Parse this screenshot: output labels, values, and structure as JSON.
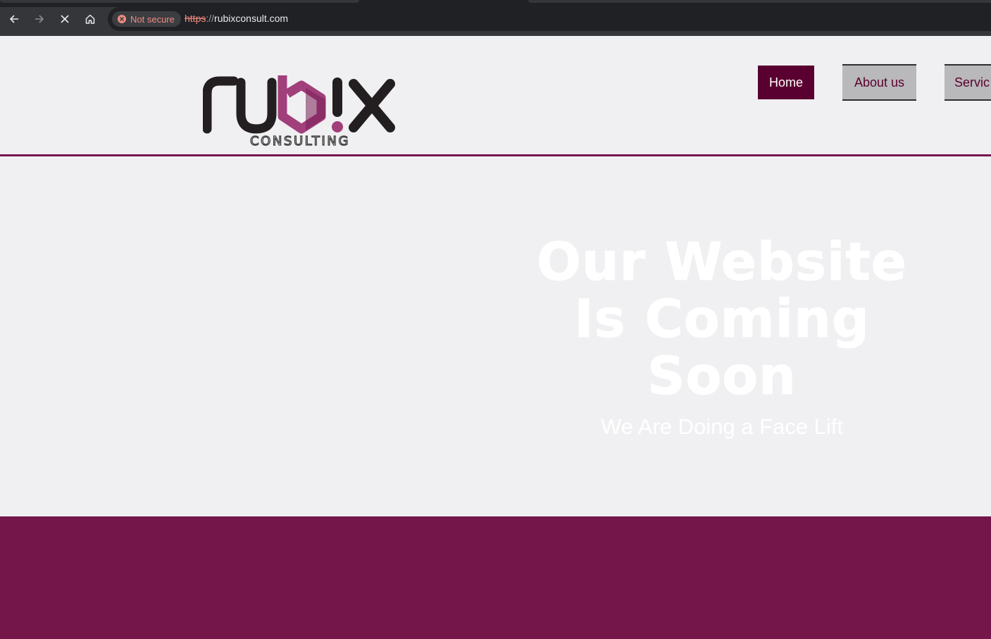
{
  "browser": {
    "security_label": "Not secure",
    "url_scheme": "https",
    "url_separator": "://",
    "url_host": "rubixconsult.com"
  },
  "site": {
    "logo_text": "rub!x",
    "logo_subtext": "CONSULTING",
    "nav": {
      "home": "Home",
      "about": "About us",
      "services": "Servic"
    },
    "hero": {
      "title_line1": "Our Website",
      "title_line2": "Is Coming",
      "title_line3": "Soon",
      "subtitle": "We Are Doing a Face Lift"
    }
  },
  "colors": {
    "brand": "#75164a",
    "brand_dark": "#5a0030",
    "page_bg": "#f0f0f2"
  }
}
